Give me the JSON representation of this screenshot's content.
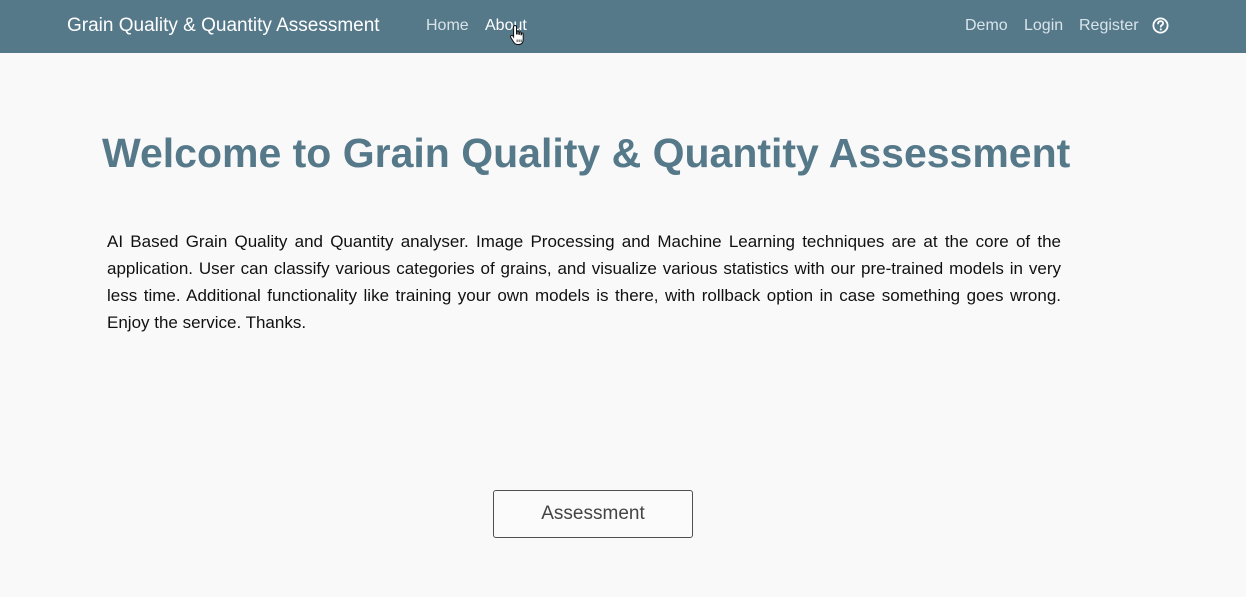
{
  "brand": {
    "title": "Grain Quality & Quantity Assessment"
  },
  "nav": {
    "left": [
      {
        "label": "Home"
      },
      {
        "label": "About",
        "active": true
      }
    ],
    "right": [
      {
        "label": "Demo"
      },
      {
        "label": "Login"
      },
      {
        "label": "Register"
      }
    ],
    "help_icon": "question-circle-icon"
  },
  "main": {
    "heading": "Welcome to Grain Quality & Quantity Assessment",
    "description": "AI Based Grain Quality and Quantity analyser. Image Processing and Machine Learning techniques are at the core of the application. User can classify various categories of grains, and visualize various statistics with our pre-trained models in very less time. Additional functionality like training your own models is there, with rollback option in case something goes wrong. Enjoy the service. Thanks.",
    "button_label": "Assessment"
  },
  "colors": {
    "navbar": "#56798a",
    "heading": "#56798a",
    "background": "#f9f9fa"
  }
}
